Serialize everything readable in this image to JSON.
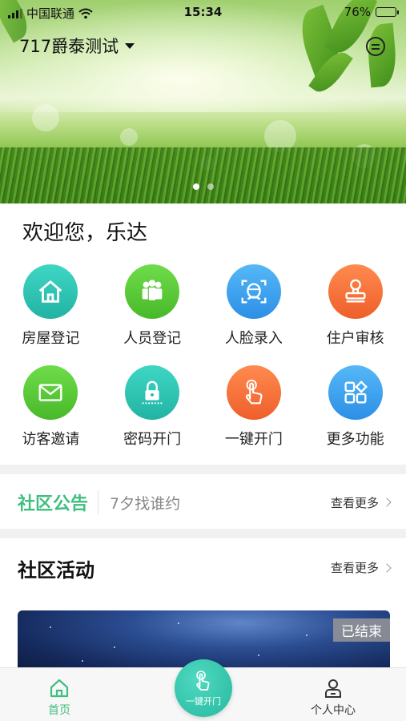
{
  "status_bar": {
    "carrier": "中国联通",
    "time": "15:34",
    "battery": "76%",
    "battery_level": 0.76,
    "icons": [
      "signal-icon",
      "wifi-icon",
      "battery-icon"
    ]
  },
  "header": {
    "community_name": "717爵泰测试",
    "banner_pages": 2,
    "banner_active_index": 0
  },
  "welcome": {
    "text": "欢迎您，乐达"
  },
  "features": [
    {
      "label": "房屋登记",
      "icon": "house-icon",
      "color": "#2cc4b4"
    },
    {
      "label": "人员登记",
      "icon": "people-icon",
      "color": "#5ccd3a"
    },
    {
      "label": "人脸录入",
      "icon": "face-scan-icon",
      "color": "#3fa6f0"
    },
    {
      "label": "住户审核",
      "icon": "stamp-icon",
      "color": "#f47a3c"
    },
    {
      "label": "访客邀请",
      "icon": "envelope-icon",
      "color": "#5ccd3a"
    },
    {
      "label": "密码开门",
      "icon": "lock-icon",
      "color": "#2cc4b4"
    },
    {
      "label": "一键开门",
      "icon": "tap-hand-icon",
      "color": "#f47a3c"
    },
    {
      "label": "更多功能",
      "icon": "grid-more-icon",
      "color": "#3fa6f0"
    }
  ],
  "notice": {
    "title": "社区公告",
    "text": "7夕找谁约",
    "more": "查看更多"
  },
  "activities": {
    "title": "社区活动",
    "more": "查看更多",
    "card_status": "已结束"
  },
  "tabbar": {
    "home": "首页",
    "center": "一键开门",
    "me": "个人中心",
    "accent": "#3fbf7f"
  }
}
